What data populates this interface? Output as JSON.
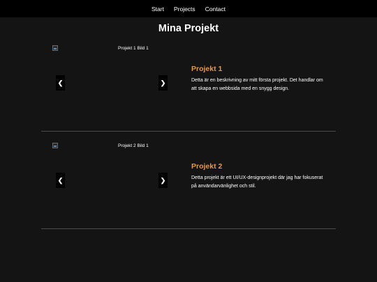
{
  "nav": {
    "items": [
      {
        "label": "Start"
      },
      {
        "label": "Projects"
      },
      {
        "label": "Contact"
      }
    ]
  },
  "page": {
    "title": "Mina Projekt"
  },
  "projects": [
    {
      "image_alt": "Projekt 1 Bild 1",
      "prev_label": "❮",
      "next_label": "❯",
      "title": "Projekt 1",
      "description": "Detta är en beskrivning av mitt första projekt. Det handlar om att skapa en webbsida med en snygg design."
    },
    {
      "image_alt": "Projekt 2 Bild 1",
      "prev_label": "❮",
      "next_label": "❯",
      "title": "Projekt 2",
      "description": "Detta projekt är ett UI/UX-designprojekt där jag har fokuserat på användarvänlighet och stil."
    }
  ],
  "colors": {
    "background": "#141414",
    "navbar": "#000000",
    "accent": "#e8964a",
    "divider": "#4a4a4a"
  }
}
